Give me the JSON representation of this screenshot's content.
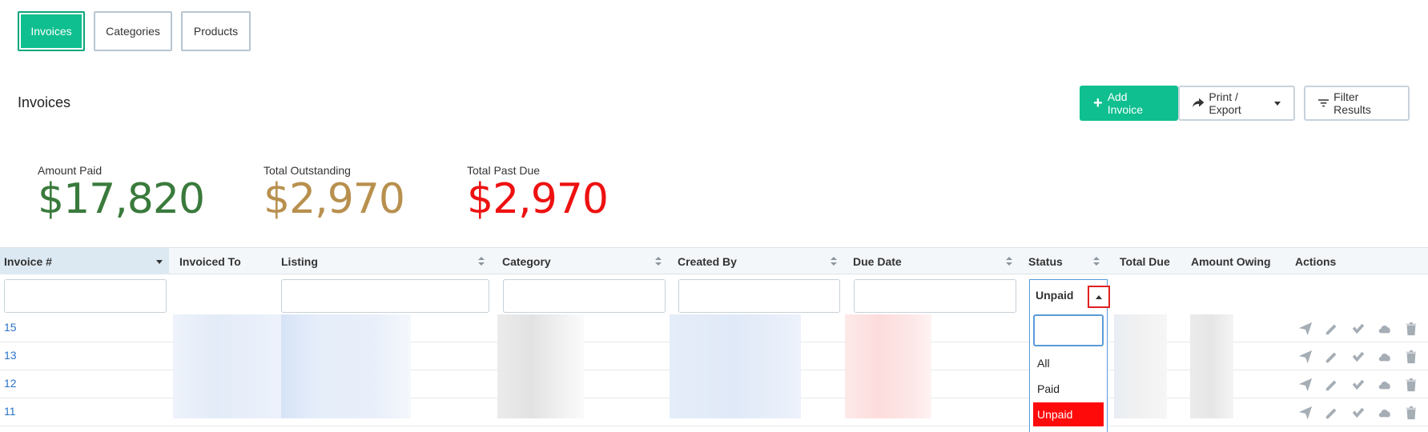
{
  "tabs": [
    {
      "label": "Invoices",
      "active": true
    },
    {
      "label": "Categories",
      "active": false
    },
    {
      "label": "Products",
      "active": false
    }
  ],
  "page_title": "Invoices",
  "toolbar": {
    "add_label": "Add Invoice",
    "print_label": "Print / Export",
    "filter_label": "Filter Results"
  },
  "stats": [
    {
      "label": "Amount Paid",
      "value": "$17,820",
      "color": "#3a7a3c"
    },
    {
      "label": "Total Outstanding",
      "value": "$2,970",
      "color": "#b8904e"
    },
    {
      "label": "Total Past Due",
      "value": "$2,970",
      "color": "#ee1111"
    }
  ],
  "columns": [
    {
      "label": "Invoice #"
    },
    {
      "label": "Invoiced To"
    },
    {
      "label": "Listing"
    },
    {
      "label": "Category"
    },
    {
      "label": "Created By"
    },
    {
      "label": "Due Date"
    },
    {
      "label": "Status"
    },
    {
      "label": "Total Due"
    },
    {
      "label": "Amount Owing"
    },
    {
      "label": "Actions"
    }
  ],
  "status_filter": {
    "selected": "Unpaid",
    "options": [
      "All",
      "Paid",
      "Unpaid"
    ]
  },
  "rows": [
    {
      "invoice": "15"
    },
    {
      "invoice": "13"
    },
    {
      "invoice": "12"
    },
    {
      "invoice": "11"
    }
  ],
  "colors": {
    "brand": "#0fbf8f",
    "link": "#2a73c9",
    "highlight": "#ff0a0a"
  }
}
